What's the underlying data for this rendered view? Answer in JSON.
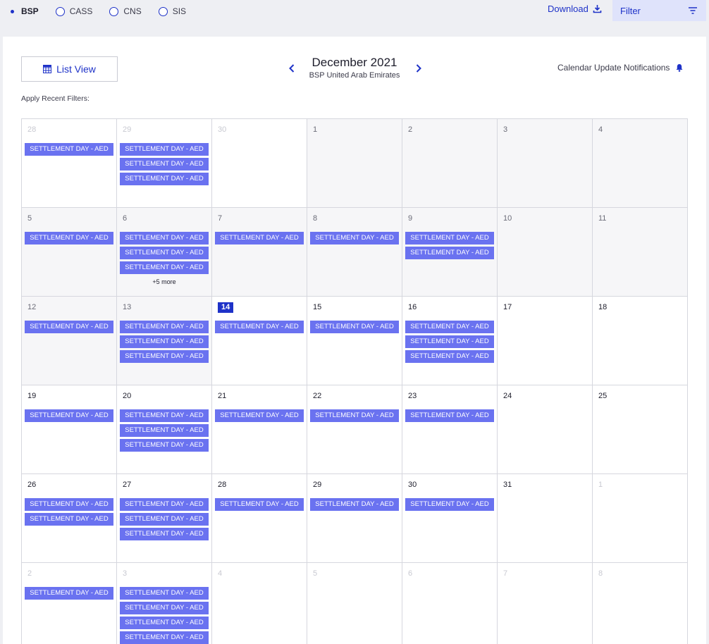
{
  "radios": [
    {
      "label": "BSP",
      "checked": true
    },
    {
      "label": "CASS",
      "checked": false
    },
    {
      "label": "CNS",
      "checked": false
    },
    {
      "label": "SIS",
      "checked": false
    }
  ],
  "toolbar": {
    "download_label": "Download",
    "filter_label": "Filter"
  },
  "header": {
    "list_view_label": "List View",
    "month_title": "December 2021",
    "month_subtitle": "BSP United Arab Emirates",
    "notifications_label": "Calendar Update Notifications",
    "recent_filters_label": "Apply Recent Filters:"
  },
  "colors": {
    "accent": "#1e32c8",
    "event": "#6a72f0",
    "filter_bg": "#dfe3fb"
  },
  "calendar": {
    "event_label": "SETTLEMENT DAY - AED",
    "weeks": [
      [
        {
          "day": "28",
          "state": "other",
          "events": 1
        },
        {
          "day": "29",
          "state": "other",
          "events": 3
        },
        {
          "day": "30",
          "state": "other",
          "events": 0
        },
        {
          "day": "1",
          "state": "past",
          "events": 0
        },
        {
          "day": "2",
          "state": "past",
          "events": 0
        },
        {
          "day": "3",
          "state": "past",
          "events": 0
        },
        {
          "day": "4",
          "state": "past",
          "events": 0
        }
      ],
      [
        {
          "day": "5",
          "state": "past",
          "events": 1
        },
        {
          "day": "6",
          "state": "past",
          "events": 3,
          "more": "+5 more"
        },
        {
          "day": "7",
          "state": "past",
          "events": 1
        },
        {
          "day": "8",
          "state": "past",
          "events": 1
        },
        {
          "day": "9",
          "state": "past",
          "events": 2
        },
        {
          "day": "10",
          "state": "past",
          "events": 0
        },
        {
          "day": "11",
          "state": "past",
          "events": 0
        }
      ],
      [
        {
          "day": "12",
          "state": "past",
          "events": 1
        },
        {
          "day": "13",
          "state": "past",
          "events": 3
        },
        {
          "day": "14",
          "state": "today",
          "events": 1
        },
        {
          "day": "15",
          "state": "current",
          "events": 1
        },
        {
          "day": "16",
          "state": "current",
          "events": 3
        },
        {
          "day": "17",
          "state": "current",
          "events": 0
        },
        {
          "day": "18",
          "state": "current",
          "events": 0
        }
      ],
      [
        {
          "day": "19",
          "state": "current",
          "events": 1
        },
        {
          "day": "20",
          "state": "current",
          "events": 3
        },
        {
          "day": "21",
          "state": "current",
          "events": 1
        },
        {
          "day": "22",
          "state": "current",
          "events": 1
        },
        {
          "day": "23",
          "state": "current",
          "events": 1
        },
        {
          "day": "24",
          "state": "current",
          "events": 0
        },
        {
          "day": "25",
          "state": "current",
          "events": 0
        }
      ],
      [
        {
          "day": "26",
          "state": "current",
          "events": 2
        },
        {
          "day": "27",
          "state": "current",
          "events": 3
        },
        {
          "day": "28",
          "state": "current",
          "events": 1
        },
        {
          "day": "29",
          "state": "current",
          "events": 1
        },
        {
          "day": "30",
          "state": "current",
          "events": 1
        },
        {
          "day": "31",
          "state": "current",
          "events": 0
        },
        {
          "day": "1",
          "state": "other",
          "events": 0
        }
      ],
      [
        {
          "day": "2",
          "state": "other",
          "events": 1
        },
        {
          "day": "3",
          "state": "other",
          "events": 4
        },
        {
          "day": "4",
          "state": "other",
          "events": 0
        },
        {
          "day": "5",
          "state": "other",
          "events": 0
        },
        {
          "day": "6",
          "state": "other",
          "events": 0
        },
        {
          "day": "7",
          "state": "other",
          "events": 0
        },
        {
          "day": "8",
          "state": "other",
          "events": 0
        }
      ]
    ]
  }
}
